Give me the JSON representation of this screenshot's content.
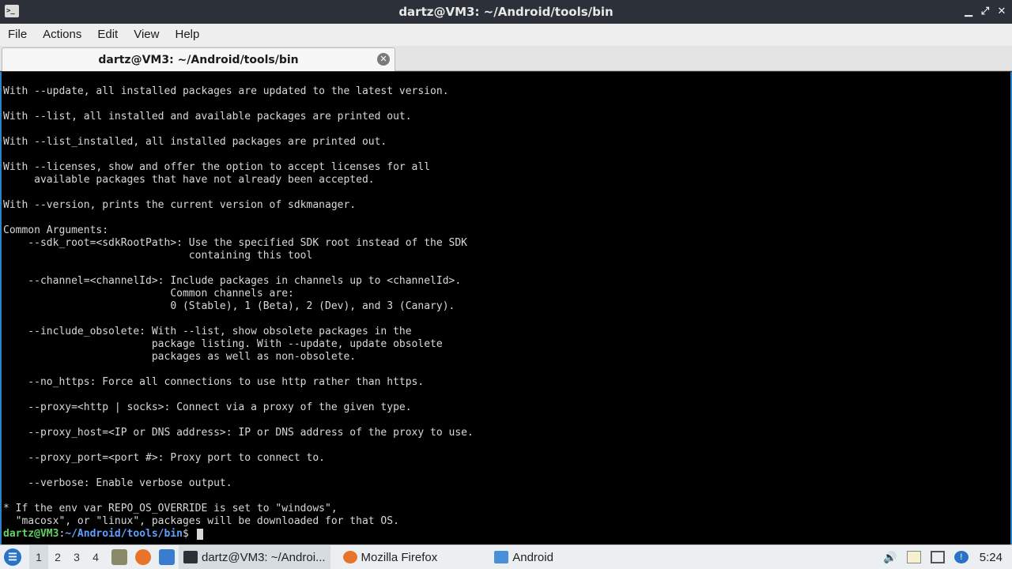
{
  "window": {
    "title": "dartz@VM3: ~/Android/tools/bin",
    "icon": "terminal-icon",
    "controls": {
      "minimize": "▁",
      "maximize": "⤢",
      "close": "✕"
    }
  },
  "menubar": {
    "items": [
      "File",
      "Actions",
      "Edit",
      "View",
      "Help"
    ]
  },
  "tabs": [
    {
      "label": "dartz@VM3: ~/Android/tools/bin",
      "close_icon": "close-icon"
    }
  ],
  "terminal": {
    "lines": [
      "With --update, all installed packages are updated to the latest version.",
      "",
      "With --list, all installed and available packages are printed out.",
      "",
      "With --list_installed, all installed packages are printed out.",
      "",
      "With --licenses, show and offer the option to accept licenses for all",
      "     available packages that have not already been accepted.",
      "",
      "With --version, prints the current version of sdkmanager.",
      "",
      "Common Arguments:",
      "    --sdk_root=<sdkRootPath>: Use the specified SDK root instead of the SDK",
      "                              containing this tool",
      "",
      "    --channel=<channelId>: Include packages in channels up to <channelId>.",
      "                           Common channels are:",
      "                           0 (Stable), 1 (Beta), 2 (Dev), and 3 (Canary).",
      "",
      "    --include_obsolete: With --list, show obsolete packages in the",
      "                        package listing. With --update, update obsolete",
      "                        packages as well as non-obsolete.",
      "",
      "    --no_https: Force all connections to use http rather than https.",
      "",
      "    --proxy=<http | socks>: Connect via a proxy of the given type.",
      "",
      "    --proxy_host=<IP or DNS address>: IP or DNS address of the proxy to use.",
      "",
      "    --proxy_port=<port #>: Proxy port to connect to.",
      "",
      "    --verbose: Enable verbose output.",
      "",
      "* If the env var REPO_OS_OVERRIDE is set to \"windows\",",
      "  \"macosx\", or \"linux\", packages will be downloaded for that OS."
    ],
    "prompt": {
      "user": "dartz@VM3",
      "colon": ":",
      "path": "~/Android/tools/bin",
      "dollar": "$ "
    }
  },
  "taskbar": {
    "desktops": [
      "1",
      "2",
      "3",
      "4"
    ],
    "tasks": [
      {
        "label": "dartz@VM3: ~/Androi...",
        "icon": "terminal-icon"
      },
      {
        "label": "Mozilla Firefox",
        "icon": "firefox-icon"
      },
      {
        "label": "Android",
        "icon": "folder-icon"
      }
    ],
    "clock": "5:24"
  },
  "colors": {
    "terminal_bg": "#000000",
    "terminal_fg": "#d8d8d8",
    "prompt_user": "#5fd35f",
    "prompt_path": "#5fa0ff",
    "accent": "#2f80c8"
  }
}
